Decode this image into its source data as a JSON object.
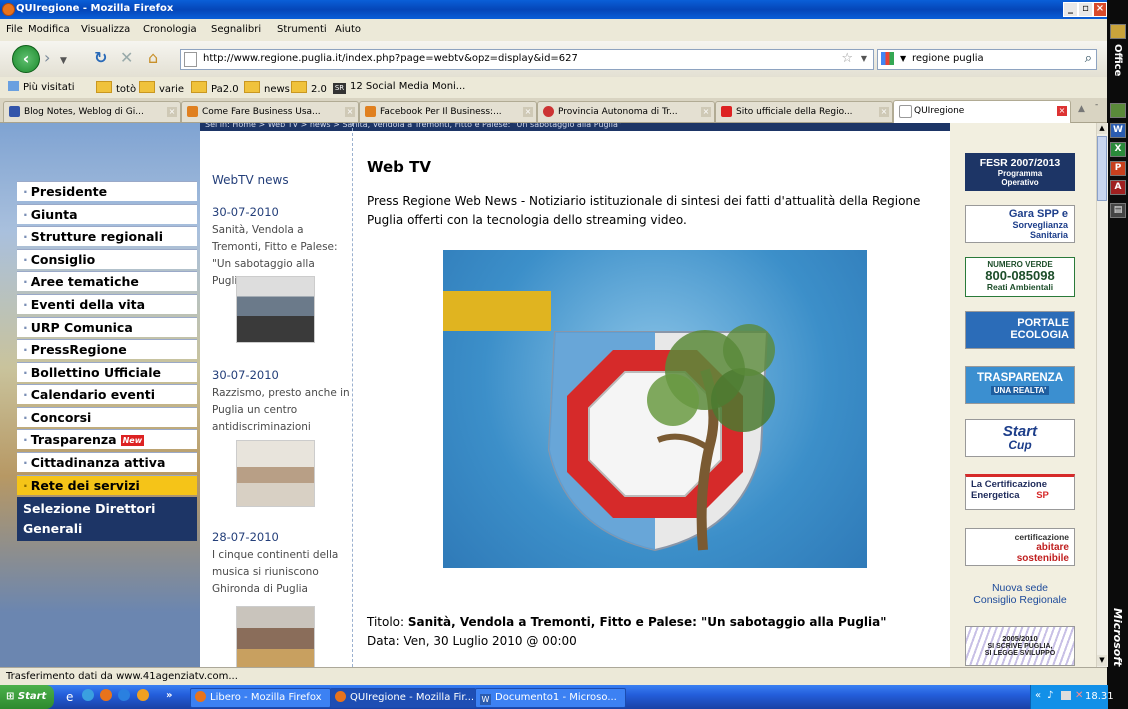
{
  "window": {
    "title": "QUIregione - Mozilla Firefox"
  },
  "menu": [
    "File",
    "Modifica",
    "Visualizza",
    "Cronologia",
    "Segnalibri",
    "Strumenti",
    "Aiuto"
  ],
  "address": {
    "url": "http://www.regione.puglia.it/index.php?page=webtv&opz=display&id=627"
  },
  "search": {
    "value": "regione puglia"
  },
  "bookmarks": [
    "Più visitati",
    "totò",
    "varie",
    "Pa2.0",
    "news",
    "2.0",
    "12 Social Media Moni..."
  ],
  "tabs": [
    {
      "label": "Blog Notes, Weblog di Gi...",
      "color": "#3355aa"
    },
    {
      "label": "Come Fare Business Usa...",
      "color": "#e08020"
    },
    {
      "label": "Facebook Per Il Business:...",
      "color": "#e08020"
    },
    {
      "label": "Provincia Autonoma di Tr...",
      "color": "#cc3333"
    },
    {
      "label": "Sito ufficiale della Regio...",
      "color": "#dd2222"
    },
    {
      "label": "QUIregione",
      "color": "#ffffff"
    }
  ],
  "breadcrumb": "Sei in: Home > Web TV > news > Sanità, Vendola a Tremonti, Fitto e Palese: \"Un sabotaggio alla Puglia\"",
  "sidebar": {
    "items": [
      "Presidente",
      "Giunta",
      "Strutture regionali",
      "Consiglio",
      "Aree tematiche",
      "Eventi della vita",
      "URP Comunica",
      "PressRegione",
      "Bollettino Ufficiale",
      "Calendario eventi",
      "Concorsi",
      "Trasparenza",
      "Cittadinanza attiva",
      "Rete dei servizi"
    ],
    "new_badge": "New",
    "dark_item": "Selezione Direttori Generali"
  },
  "news": {
    "heading": "WebTV news",
    "items": [
      {
        "date": "30-07-2010",
        "title": "Sanità, Vendola a Tremonti, Fitto e Palese: \"Un sabotaggio alla Puglia\""
      },
      {
        "date": "30-07-2010",
        "title": "Razzismo, presto anche in Puglia un centro antidiscriminazioni"
      },
      {
        "date": "28-07-2010",
        "title": "I cinque continenti della musica si riuniscono Ghironda di Puglia"
      }
    ]
  },
  "main": {
    "title": "Web TV",
    "intro": "Press Regione Web News - Notiziario istituzionale di sintesi dei fatti d'attualità della Regione Puglia offerti con la tecnologia dello streaming video.",
    "titolo_label": "Titolo: ",
    "titolo_value": "Sanità, Vendola a Tremonti, Fitto e Palese: \"Un sabotaggio alla Puglia\"",
    "data_label": "Data: ",
    "data_value": "Ven, 30 Luglio 2010 @ 00:00"
  },
  "banners": {
    "fesr": "FESR 2007/2013",
    "fesr_sub1": "Programma",
    "fesr_sub2": "Operativo",
    "gara1": "Gara SPP e",
    "gara2": "Sorveglianza",
    "gara3": "Sanitaria",
    "nv1": "NUMERO VERDE",
    "nv2": "800-085098",
    "nv3": "Reati Ambientali",
    "portale1": "PORTALE",
    "portale2": "ECOLOGIA",
    "trasp1": "TRASPARENZA",
    "trasp2": "UNA REALTA'",
    "start1": "Start",
    "start2": "Cup",
    "cert1": "La Certificazione",
    "cert2": "Energetica",
    "cert3": "SP",
    "abit1": "certificazione",
    "abit2": "abitare",
    "abit3": "sostenibile",
    "sede1": "Nuova sede",
    "sede2": "Consiglio Regionale",
    "svil1": "2005/2010",
    "svil2": "SI SCRIVE PUGLIA,",
    "svil3": "SI LEGGE SVILUPPO"
  },
  "status": {
    "text": "Trasferimento dati da www.41agenziatv.com..."
  },
  "taskbar": {
    "start": "Start",
    "items": [
      "Libero - Mozilla Firefox",
      "QUIregione - Mozilla Fir...",
      "Documento1 - Microso..."
    ],
    "clock": "18.31"
  },
  "office": {
    "label": "Office",
    "ms": "Microsoft"
  }
}
